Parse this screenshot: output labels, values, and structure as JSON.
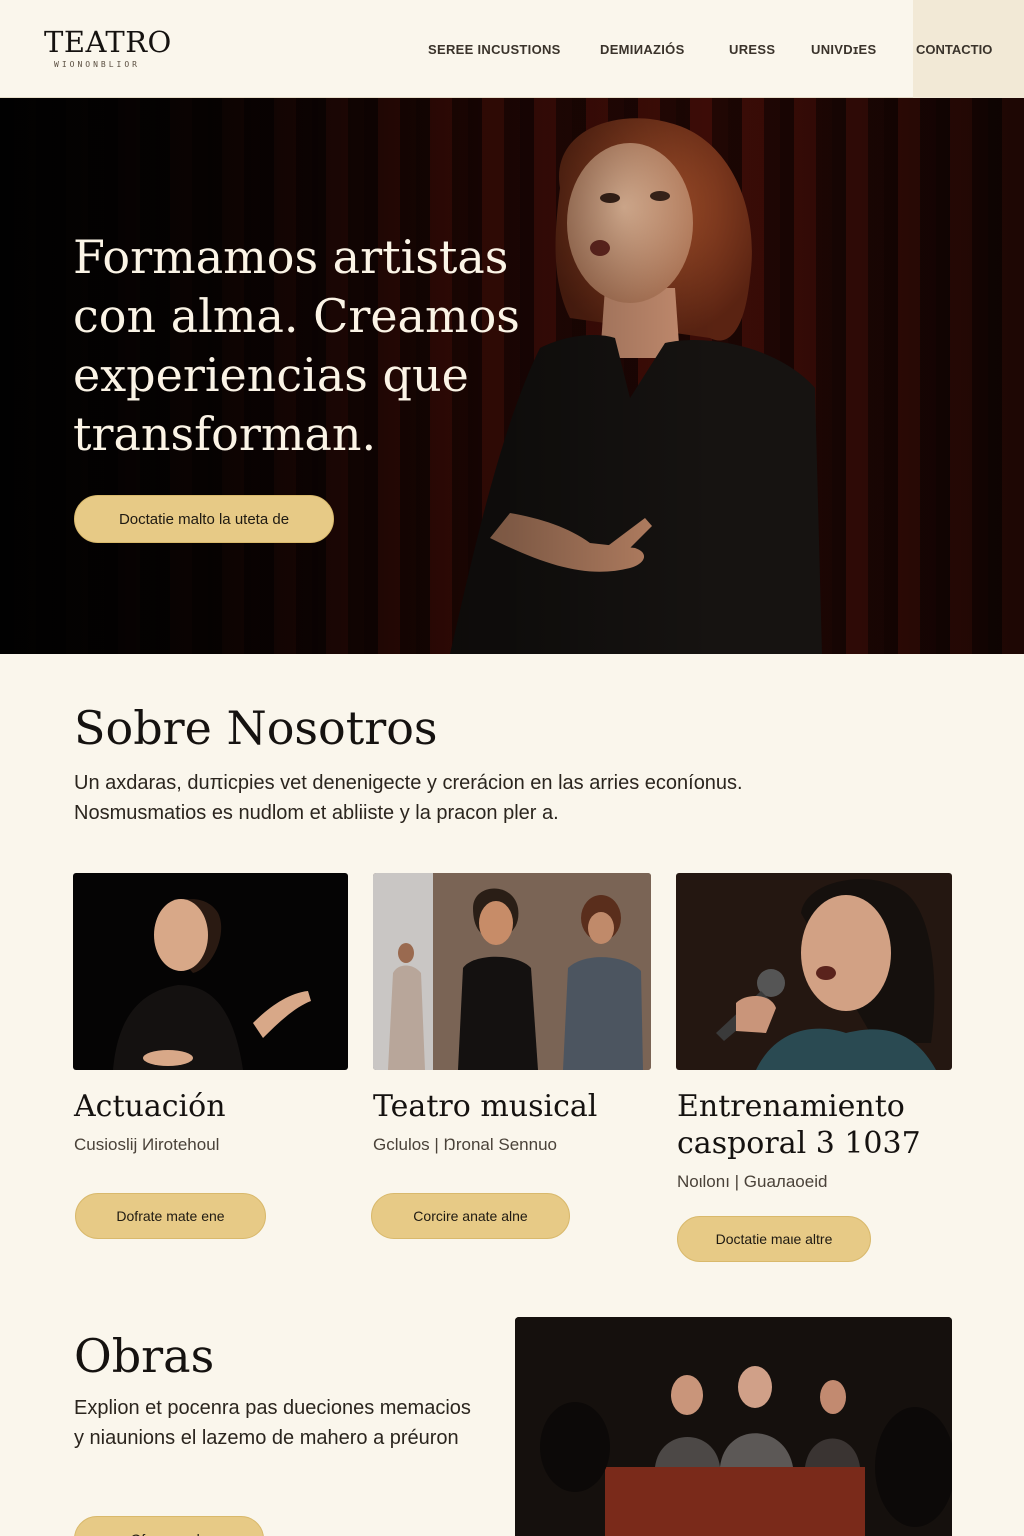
{
  "header": {
    "logo_title": "TEATRO",
    "logo_subtitle": "WIONONBLIOR",
    "nav": [
      {
        "label": "SEREE INCUSTIONS"
      },
      {
        "label": "DEMIИAZIÓS"
      },
      {
        "label": "URESS"
      },
      {
        "label": "UNIVDɪES"
      },
      {
        "label": "CONTACTIO"
      }
    ]
  },
  "hero": {
    "title": "Formamos artistas con alma. Creamos experiencias que transforman.",
    "cta_label": "Doctatie malto la uteta de"
  },
  "sobre": {
    "title": "Sobre Nosotros",
    "text": "Un axdaras, duπicpies vet denenigecte y crerácion en las arries econíonus. Nosmusmatios es nudlom et abliiste y la pracon pler a."
  },
  "cards": [
    {
      "title": "Actuación",
      "meta": "Cusioslij Иirotehoul",
      "cta_label": "Dofrate mate ene"
    },
    {
      "title": "Teatro musical",
      "meta": "Gclulos  |  Ŋronal Sennuo",
      "cta_label": "Corcire anate alne"
    },
    {
      "title": "Entrenamiento casporal 3 1037",
      "meta": "Noιlonı  |  Guaлaoeid",
      "cta_label": "Doctatie maιe altre"
    }
  ],
  "obras": {
    "title": "Obras",
    "text": "Explion et pocenra pas dueciones memacios y niaunions el lazemo de mahero a préuron",
    "cta_label": "Ofre arsuelo"
  },
  "colors": {
    "background": "#faf6ec",
    "accent_button": "#e7ca86",
    "curtain_red": "#4a0f08",
    "text_dark": "#151210"
  }
}
